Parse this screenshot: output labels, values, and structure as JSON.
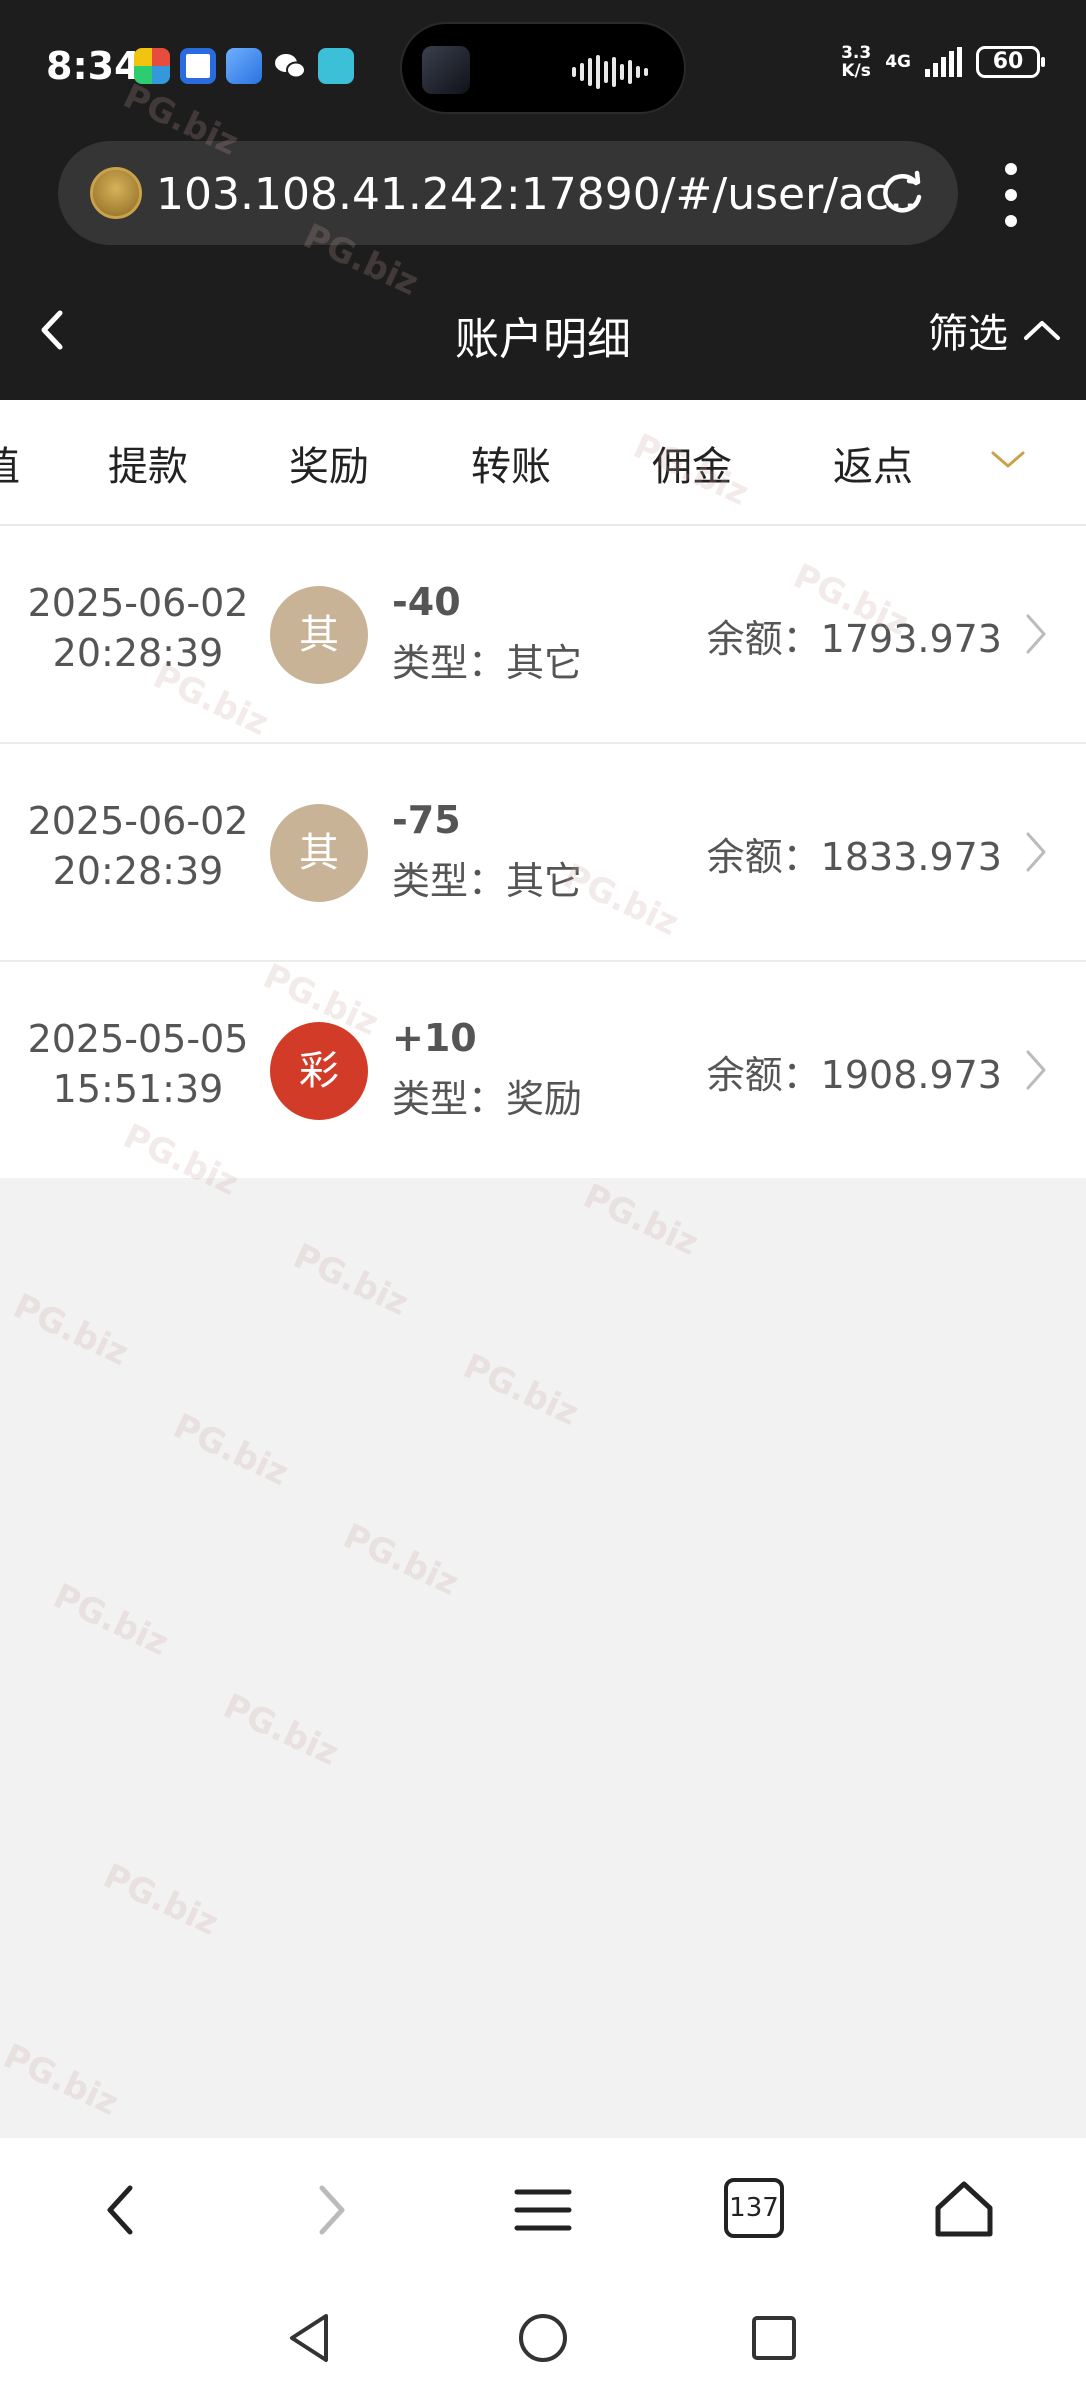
{
  "status_bar": {
    "time": "8:34",
    "net_speed_value": "3.3",
    "net_speed_unit": "K/s",
    "network": "4G",
    "battery": "60"
  },
  "browser": {
    "url": "103.108.41.242:17890/#/user/ac...",
    "tabs_count": "137"
  },
  "header": {
    "title": "账户明细",
    "filter_label": "筛选"
  },
  "tabs": [
    {
      "label": "充值",
      "partial": true
    },
    {
      "label": "提款"
    },
    {
      "label": "奖励"
    },
    {
      "label": "转账"
    },
    {
      "label": "佣金"
    },
    {
      "label": "返点"
    }
  ],
  "records": [
    {
      "date": "2025-06-02",
      "time": "20:28:39",
      "badge": "其",
      "badge_color": "#c8b397",
      "amount": "-40",
      "type": "类型：其它",
      "balance": "余额：1793.973"
    },
    {
      "date": "2025-06-02",
      "time": "20:28:39",
      "badge": "其",
      "badge_color": "#c8b397",
      "amount": "-75",
      "type": "类型：其它",
      "balance": "余额：1833.973"
    },
    {
      "date": "2025-05-05",
      "time": "15:51:39",
      "badge": "彩",
      "badge_color": "#d23b28",
      "amount": "+10",
      "type": "类型：奖励",
      "balance": "余额：1908.973"
    }
  ],
  "watermark_text": "PG.biz",
  "colors": {
    "header_bg": "#1d1d1d",
    "accent_gold": "#c9a24a"
  }
}
